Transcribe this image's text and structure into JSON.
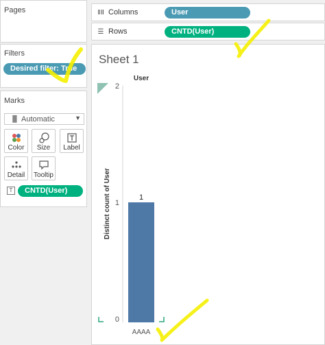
{
  "pages": {
    "title": "Pages"
  },
  "filters": {
    "title": "Filters",
    "pill_label": "Desired filter: True"
  },
  "marks": {
    "title": "Marks",
    "mark_type": "Automatic",
    "buttons": [
      {
        "label": "Color",
        "icon": "color-dots-icon"
      },
      {
        "label": "Size",
        "icon": "size-circles-icon"
      },
      {
        "label": "Label",
        "icon": "text-label-icon"
      },
      {
        "label": "Detail",
        "icon": "detail-dots-icon"
      },
      {
        "label": "Tooltip",
        "icon": "tooltip-bubble-icon"
      }
    ],
    "pill_label": "CNTD(User)"
  },
  "shelves": {
    "columns_label": "Columns",
    "columns_pill": "User",
    "rows_label": "Rows",
    "rows_pill": "CNTD(User)"
  },
  "sheet": {
    "title": "Sheet 1"
  },
  "colors": {
    "dimension_pill": "#4a9ab3",
    "measure_pill": "#00b180",
    "filter_pill": "#4a9ab3",
    "bar": "#4e79a7",
    "annotation": "#f5f000"
  },
  "chart_data": {
    "type": "bar",
    "categories": [
      "AAAA"
    ],
    "values": [
      1
    ],
    "data_labels": [
      "1"
    ],
    "column_header": "User",
    "ylabel": "Distinct count of User",
    "ylim": [
      0,
      2
    ],
    "yticks": [
      0,
      1,
      2
    ],
    "grid": false
  }
}
